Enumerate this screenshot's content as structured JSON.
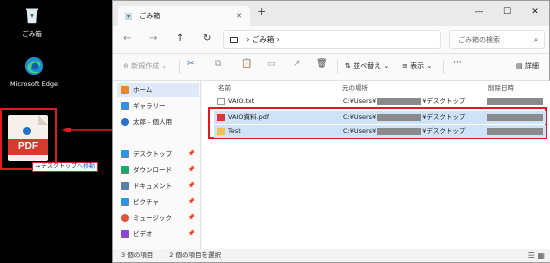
{
  "desktop": {
    "recycle_bin": "ごみ箱",
    "edge": "Microsoft Edge",
    "pdf_icon_text": "PDF",
    "move_tooltip": {
      "arrow": "→",
      "target": "デスクトップ",
      "action": "へ移動"
    }
  },
  "window": {
    "tab_title": "ごみ箱",
    "tab_close": "✕",
    "new_tab": "+",
    "minimize": "—",
    "maximize": "☐",
    "close": "✕",
    "nav": {
      "back": "←",
      "forward": "→",
      "up": "↑",
      "refresh": "↻"
    },
    "path": {
      "sep1": "›",
      "location": "ごみ箱",
      "sep2": "›"
    },
    "search_placeholder": "ごみ箱の検索",
    "toolbar": {
      "new": "⊕ 新規作成 ⌄",
      "cut": "✂",
      "copy": "⧉",
      "paste": "📋",
      "rename": "▭",
      "share": "↗",
      "delete": "🗑",
      "sort": "⇅ 並べ替え ⌄",
      "view": "≡ 表示 ⌄",
      "more": "···",
      "details": "▤ 詳細"
    }
  },
  "sidebar": {
    "items": [
      {
        "label": "ホーム",
        "color": "#e0893a"
      },
      {
        "label": "ギャラリー",
        "color": "#3a8fd6"
      },
      {
        "label": "太郎 - 個人用",
        "color": "#2a6fc9"
      },
      {
        "label": "デスクトップ",
        "color": "#3a8fd6"
      },
      {
        "label": "ダウンロード",
        "color": "#2ba06c"
      },
      {
        "label": "ドキュメント",
        "color": "#5a7fa8"
      },
      {
        "label": "ピクチャ",
        "color": "#3a8fd6"
      },
      {
        "label": "ミュージック",
        "color": "#e0533a"
      },
      {
        "label": "ビデオ",
        "color": "#8a4ac9"
      }
    ],
    "pin": "📌"
  },
  "list": {
    "columns": {
      "name": "名前",
      "original": "元の場所",
      "deleted": "削除日時"
    },
    "rows": [
      {
        "name": "VAIO.txt",
        "loc_prefix": "C:¥Users¥",
        "loc_suffix": "¥デスクトップ",
        "selected": false
      },
      {
        "name": "VAIO資料.pdf",
        "loc_prefix": "C:¥Users¥",
        "loc_suffix": "¥デスクトップ",
        "selected": true
      },
      {
        "name": "Test",
        "loc_prefix": "C:¥Users¥",
        "loc_suffix": "¥デスクトップ",
        "selected": true
      }
    ]
  },
  "status": {
    "count": "3 個の項目",
    "selected": "2 個の項目を選択"
  },
  "colors": {
    "highlight_red": "#e01a22",
    "selection_blue": "#cfe3f8",
    "accent": "#1666c4"
  }
}
